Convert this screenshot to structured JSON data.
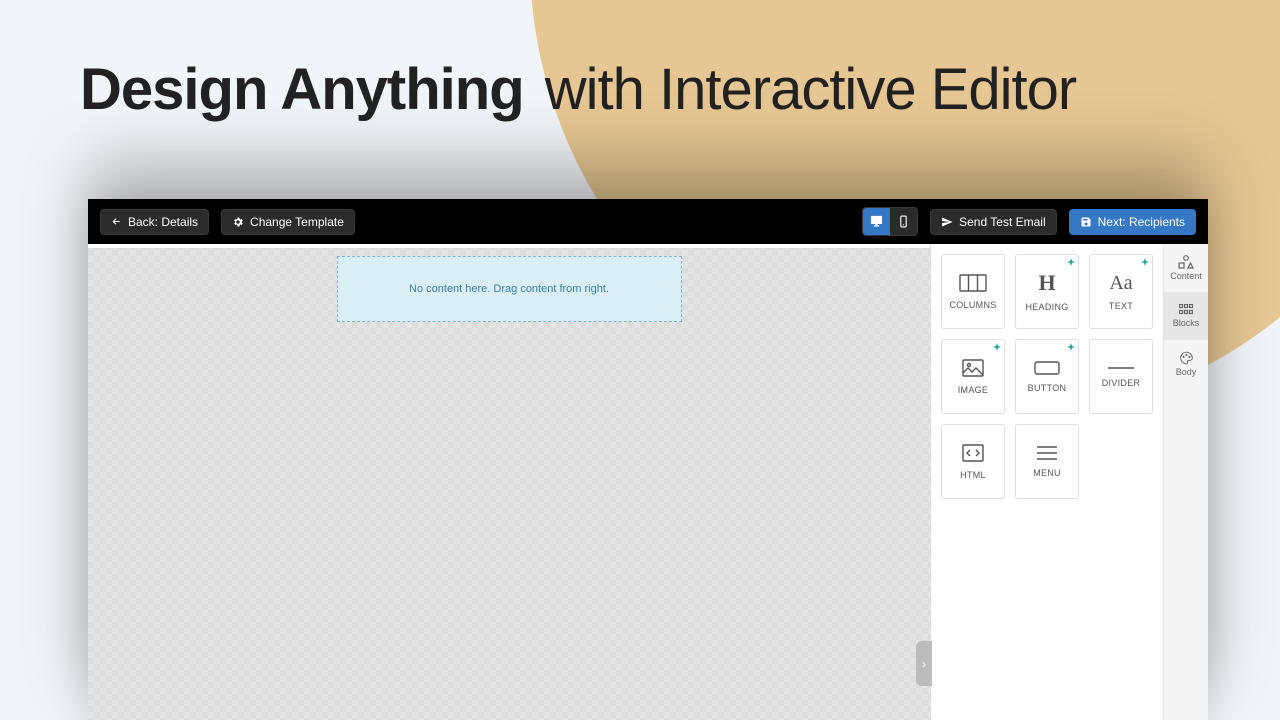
{
  "headline": {
    "bold": "Design Anything",
    "light": "with  Interactive Editor"
  },
  "toolbar": {
    "back": "Back: Details",
    "change_template": "Change Template",
    "send_test": "Send Test Email",
    "next": "Next: Recipients"
  },
  "canvas": {
    "empty_hint": "No content here. Drag content from right."
  },
  "side_tabs": {
    "content": "Content",
    "blocks": "Blocks",
    "body": "Body"
  },
  "blocks": {
    "columns": "COLUMNS",
    "heading": "HEADING",
    "text": "TEXT",
    "image": "IMAGE",
    "button": "BUTTON",
    "divider": "DIVIDER",
    "html": "HTML",
    "menu": "MENU"
  }
}
